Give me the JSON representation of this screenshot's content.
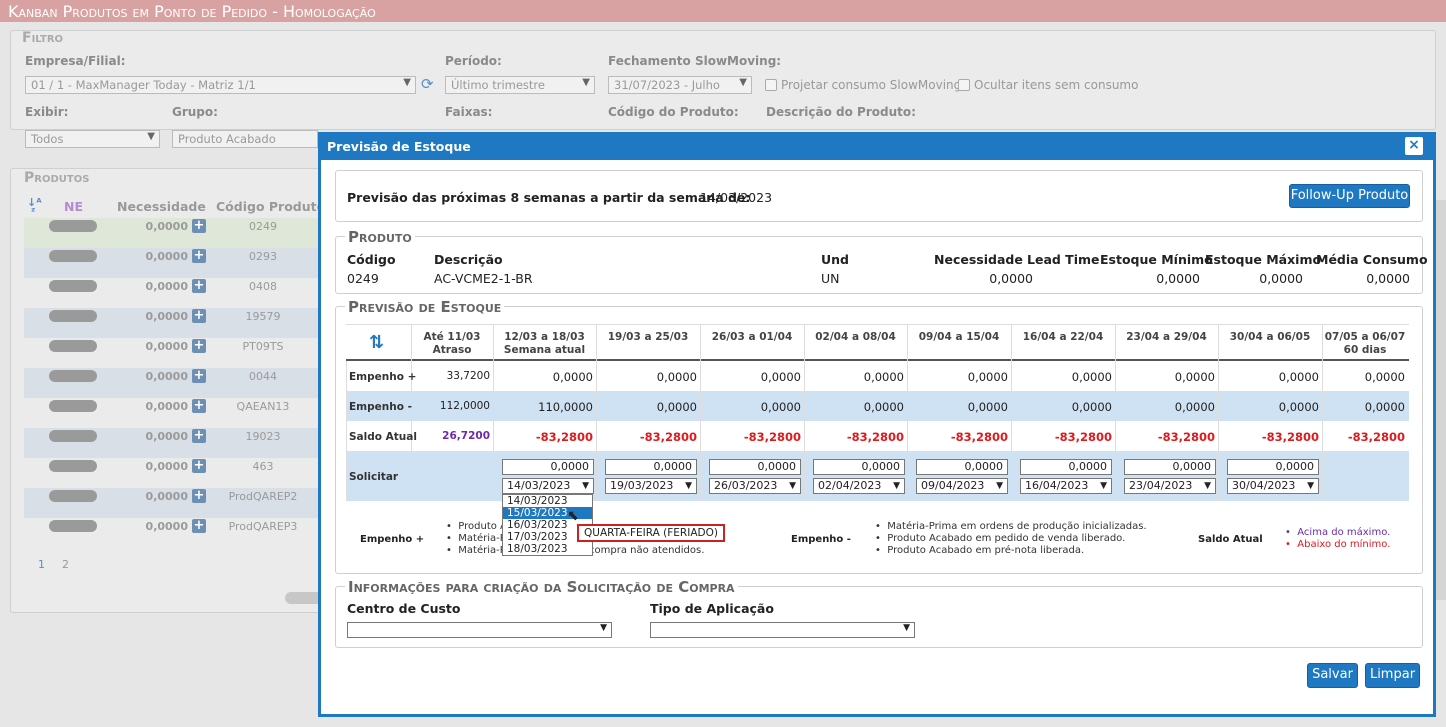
{
  "app_title": "Kanban Produtos em Ponto de Pedido  - Homologação",
  "filter": {
    "legend": "Filtro",
    "empresa_label": "Empresa/Filial:",
    "empresa_value": "01 / 1 - MaxManager Today - Matriz 1/1",
    "periodo_label": "Período:",
    "periodo_value": "Último trimestre",
    "fechamento_label": "Fechamento SlowMoving:",
    "fechamento_value": "31/07/2023 - Julho",
    "projetar_label": "Projetar consumo SlowMoving",
    "ocultar_label": "Ocultar itens sem consumo",
    "exibir_label": "Exibir:",
    "exibir_value": "Todos",
    "grupo_label": "Grupo:",
    "grupo_value": "Produto Acabado",
    "faixas_label": "Faixas:",
    "codigo_label": "Código do Produto:",
    "descricao_label": "Descrição do Produto:"
  },
  "produtos": {
    "legend": "Produtos",
    "col_ne": "NE",
    "col_necessidade": "Necessidade",
    "col_codigo": "Código Produto",
    "rows": [
      {
        "nec": "0,0000",
        "code": "0249"
      },
      {
        "nec": "0,0000",
        "code": "0293"
      },
      {
        "nec": "0,0000",
        "code": "0408"
      },
      {
        "nec": "0,0000",
        "code": "19579"
      },
      {
        "nec": "0,0000",
        "code": "PT09TS"
      },
      {
        "nec": "0,0000",
        "code": "0044"
      },
      {
        "nec": "0,0000",
        "code": "QAEAN13"
      },
      {
        "nec": "0,0000",
        "code": "19023"
      },
      {
        "nec": "0,0000",
        "code": "463"
      },
      {
        "nec": "0,0000",
        "code": "ProdQAREP2"
      },
      {
        "nec": "0,0000",
        "code": "ProdQAREP3"
      }
    ],
    "pages": [
      "1",
      "2"
    ]
  },
  "modal": {
    "title": "Previsão de Estoque",
    "close": "×",
    "forecast_label": "Previsão das próximas 8 semanas a partir da semana de:",
    "forecast_date": "14/03/2023",
    "followup_btn": "Follow-Up Produto",
    "produto": {
      "legend": "Produto",
      "h_codigo": "Código",
      "h_descricao": "Descrição",
      "h_und": "Und",
      "h_necessidade": "Necessidade",
      "h_lead": "Lead Time",
      "h_min": "Estoque Mínimo",
      "h_max": "Estoque Máximo",
      "h_media": "Média Consumo",
      "codigo": "0249",
      "descricao": "AC-VCME2-1-BR",
      "und": "UN",
      "necessidade": "0,0000",
      "lead": "",
      "min": "0,0000",
      "max": "0,0000",
      "media": "0,0000"
    },
    "previsao": {
      "legend": "Previsão de Estoque",
      "columns": [
        {
          "l1": "Até 11/03",
          "l2": "Atraso"
        },
        {
          "l1": "12/03 a 18/03",
          "l2": "Semana atual"
        },
        {
          "l1": "19/03 a 25/03",
          "l2": ""
        },
        {
          "l1": "26/03 a 01/04",
          "l2": ""
        },
        {
          "l1": "02/04 a 08/04",
          "l2": ""
        },
        {
          "l1": "09/04 a 15/04",
          "l2": ""
        },
        {
          "l1": "16/04 a 22/04",
          "l2": ""
        },
        {
          "l1": "23/04 a 29/04",
          "l2": ""
        },
        {
          "l1": "30/04 a 06/05",
          "l2": ""
        },
        {
          "l1": "07/05 a 06/07",
          "l2": "60 dias"
        }
      ],
      "row_labels": {
        "empenho_plus": "Empenho +",
        "empenho_minus": "Empenho -",
        "saldo": "Saldo Atual",
        "solicitar": "Solicitar"
      },
      "empenho_plus": [
        "33,7200",
        "0,0000",
        "0,0000",
        "0,0000",
        "0,0000",
        "0,0000",
        "0,0000",
        "0,0000",
        "0,0000",
        "0,0000"
      ],
      "empenho_minus": [
        "112,0000",
        "110,0000",
        "0,0000",
        "0,0000",
        "0,0000",
        "0,0000",
        "0,0000",
        "0,0000",
        "0,0000",
        "0,0000"
      ],
      "saldo": [
        "26,7200",
        "-83,2800",
        "-83,2800",
        "-83,2800",
        "-83,2800",
        "-83,2800",
        "-83,2800",
        "-83,2800",
        "-83,2800",
        "-83,2800"
      ],
      "solicitar_qty": [
        "0,0000",
        "0,0000",
        "0,0000",
        "0,0000",
        "0,0000",
        "0,0000",
        "0,0000",
        "0,0000"
      ],
      "solicitar_dates": [
        "14/03/2023",
        "19/03/2023",
        "26/03/2023",
        "02/04/2023",
        "09/04/2023",
        "16/04/2023",
        "23/04/2023",
        "30/04/2023"
      ],
      "dropdown_options": [
        "14/03/2023",
        "15/03/2023",
        "16/03/2023",
        "17/03/2023",
        "18/03/2023"
      ],
      "tooltip": "QUARTA-FEIRA (FERIADO)",
      "legend_empenho_plus": {
        "label": "Empenho +",
        "items": [
          "Produto A",
          "Matéria-P",
          "Matéria-P"
        ],
        "tail": "compra não atendidos."
      },
      "legend_empenho_minus": {
        "label": "Empenho -",
        "items": [
          "Matéria-Prima em ordens de produção inicializadas.",
          "Produto Acabado em pedido de venda liberado.",
          "Produto Acabado em pré-nota liberada."
        ]
      },
      "legend_saldo": {
        "label": "Saldo Atual",
        "items": [
          "Acima do máximo.",
          "Abaixo do mínimo."
        ]
      }
    },
    "compra": {
      "legend": "Informações para criação da Solicitação de Compra",
      "centro_label": "Centro de Custo",
      "tipo_label": "Tipo de Aplicação"
    },
    "save_btn": "Salvar",
    "clear_btn": "Limpar"
  },
  "colors": {
    "accent": "#1f79c2",
    "title_bar": "#d9a2a2",
    "negative": "#e0191d",
    "positive_balance": "#6d2aa8",
    "tooltip_border": "#d01f1f"
  }
}
